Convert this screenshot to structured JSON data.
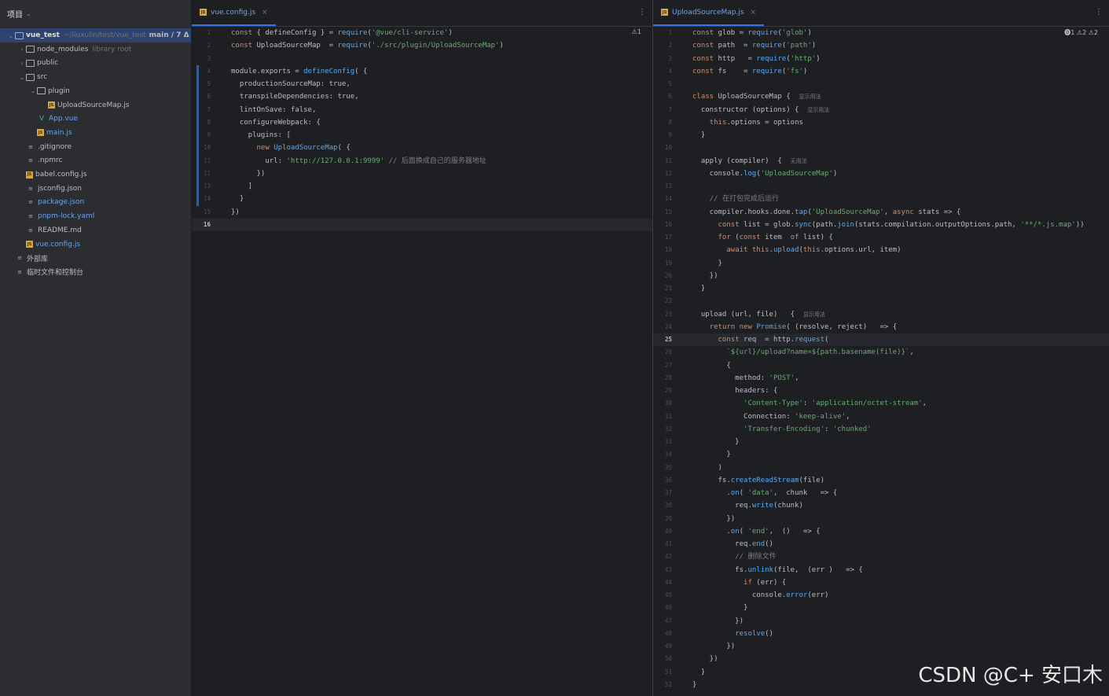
{
  "sidebar": {
    "title": "项目",
    "tree": [
      {
        "label": "vue_test",
        "hint": "~/liuxulin/test/vue_test",
        "extra": "main / 7 Δ",
        "type": "folder",
        "depth": 0,
        "open": true
      },
      {
        "label": "node_modules",
        "hint": "library root",
        "type": "folder",
        "depth": 1,
        "open": false
      },
      {
        "label": "public",
        "type": "folder",
        "depth": 1,
        "open": false
      },
      {
        "label": "src",
        "type": "folder",
        "depth": 1,
        "open": true
      },
      {
        "label": "plugin",
        "type": "folder",
        "depth": 2,
        "open": true
      },
      {
        "label": "UploadSourceMap.js",
        "type": "js",
        "depth": 3
      },
      {
        "label": "App.vue",
        "type": "vue",
        "depth": 2
      },
      {
        "label": "main.js",
        "type": "js",
        "depth": 2
      },
      {
        "label": ".gitignore",
        "type": "gen",
        "depth": 1
      },
      {
        "label": ".npmrc",
        "type": "gen",
        "depth": 1
      },
      {
        "label": "babel.config.js",
        "type": "js",
        "depth": 1
      },
      {
        "label": "jsconfig.json",
        "type": "gen",
        "depth": 1
      },
      {
        "label": "package.json",
        "type": "gen",
        "depth": 1
      },
      {
        "label": "pnpm-lock.yaml",
        "type": "gen",
        "depth": 1
      },
      {
        "label": "README.md",
        "type": "gen",
        "depth": 1
      },
      {
        "label": "vue.config.js",
        "type": "js",
        "depth": 1
      },
      {
        "label": "外部库",
        "type": "gen",
        "depth": 0
      },
      {
        "label": "临时文件和控制台",
        "type": "gen",
        "depth": 0
      }
    ]
  },
  "left_editor": {
    "tab_label": "vue.config.js",
    "indicator": "⚠1",
    "current_line": 16,
    "lines": [
      "const { defineConfig } = require('@vue/cli-service')",
      "const UploadSourceMap  = require('./src/plugin/UploadSourceMap')",
      "",
      "module.exports = defineConfig( {",
      "  productionSourceMap: true,",
      "  transpileDependencies: true,",
      "  lintOnSave: false,",
      "  configureWebpack: {",
      "    plugins: [",
      "      new UploadSourceMap( {",
      "        url: 'http://127.0.0.1:9999' // 后面换成自己的服务器地址",
      "      })",
      "    ]",
      "  }",
      "})",
      ""
    ]
  },
  "right_editor": {
    "tab_label": "UploadSourceMap.js",
    "indicators": "⓿1 ⚠2 ⚠2",
    "current_line": 25,
    "lines": [
      "const glob = require('glob')",
      "const path  = require('path')",
      "const http   = require('http')",
      "const fs    = require('fs')",
      "",
      "class UploadSourceMap {  显示用法",
      "  constructor (options) {  显示用法",
      "    this.options = options",
      "  }",
      "",
      "  apply (compiler)  {  无用法",
      "    console.log('UploadSourceMap')",
      "",
      "    // 在打包完成后运行",
      "    compiler.hooks.done.tap('UploadSourceMap', async stats => {",
      "      const list = glob.sync(path.join(stats.compilation.outputOptions.path, '**/*.js.map'))",
      "      for (const item  of list) {",
      "        await this.upload(this.options.url, item)",
      "      }",
      "    })",
      "  }",
      "",
      "  upload (url, file)   {  显示用法",
      "    return new Promise( (resolve, reject)   => {",
      "      const req  = http.request(",
      "        `${url}/upload?name=${path.basename(file)}`,",
      "        {",
      "          method: 'POST',",
      "          headers: {",
      "            'Content-Type': 'application/octet-stream',",
      "            Connection: 'keep-alive',",
      "            'Transfer-Encoding': 'chunked'",
      "          }",
      "        }",
      "      )",
      "      fs.createReadStream(file)",
      "        .on( 'data',  chunk   => {",
      "          req.write(chunk)",
      "        })",
      "        .on( 'end',  ()   => {",
      "          req.end()",
      "          // 删除文件",
      "          fs.unlink(file,  (err )   => {",
      "            if (err) {",
      "              console.error(err)",
      "            }",
      "          })",
      "          resolve()",
      "        })",
      "    })",
      "  }",
      "}"
    ]
  },
  "watermark": "CSDN @C+  安口木"
}
